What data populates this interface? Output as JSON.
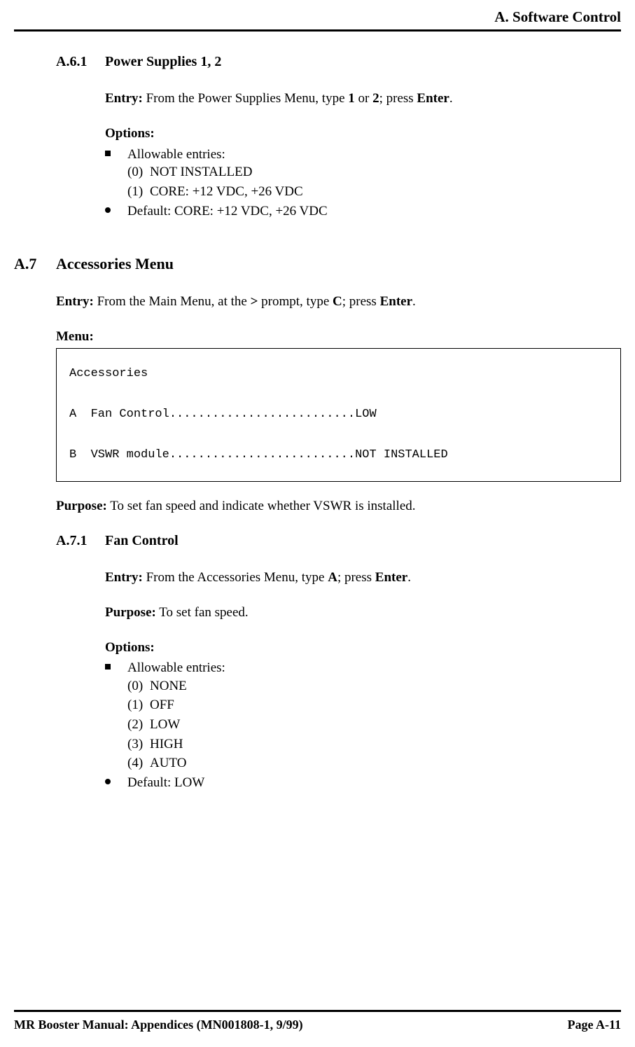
{
  "header": {
    "title": "A. Software Control"
  },
  "a61": {
    "num": "A.6.1",
    "title": "Power Supplies 1, 2",
    "entry_label": "Entry:",
    "entry_text1": " From the Power Supplies Menu, type ",
    "entry_b1": "1",
    "entry_text2": " or ",
    "entry_b2": "2",
    "entry_text3": "; press ",
    "entry_b3": "Enter",
    "entry_text4": ".",
    "options_label": "Options:",
    "allowable": "Allowable entries:",
    "opt0_num": "(0)",
    "opt0_val": "NOT INSTALLED",
    "opt1_num": "(1)",
    "opt1_val": "CORE: +12 VDC, +26 VDC",
    "default": "Default:  CORE: +12 VDC, +26 VDC"
  },
  "a7": {
    "num": "A.7",
    "title": "Accessories Menu",
    "entry_label": "Entry:",
    "entry_text1": " From the Main Menu, at the ",
    "entry_b1": ">",
    "entry_text2": " prompt, type ",
    "entry_b2": "C",
    "entry_text3": "; press ",
    "entry_b3": "Enter",
    "entry_text4": ".",
    "menu_label": "Menu:",
    "menu_line1": "Accessories",
    "menu_line2": "A  Fan Control..........................LOW",
    "menu_line3": "B  VSWR module..........................NOT INSTALLED",
    "purpose_label": "Purpose:",
    "purpose_text": " To set fan speed and indicate whether VSWR is installed."
  },
  "a71": {
    "num": "A.7.1",
    "title": "Fan Control",
    "entry_label": "Entry:",
    "entry_text1": " From the Accessories Menu, type ",
    "entry_b1": "A",
    "entry_text2": "; press ",
    "entry_b2": "Enter",
    "entry_text3": ".",
    "purpose_label": "Purpose:",
    "purpose_text": " To set fan speed.",
    "options_label": "Options:",
    "allowable": "Allowable entries:",
    "opt0_num": "(0)",
    "opt0_val": "NONE",
    "opt1_num": "(1)",
    "opt1_val": "OFF",
    "opt2_num": "(2)",
    "opt2_val": "LOW",
    "opt3_num": "(3)",
    "opt3_val": "HIGH",
    "opt4_num": "(4)",
    "opt4_val": "AUTO",
    "default": "Default: LOW"
  },
  "footer": {
    "left": "MR Booster Manual: Appendices (MN001808-1, 9/99)",
    "right": "Page A-11"
  }
}
